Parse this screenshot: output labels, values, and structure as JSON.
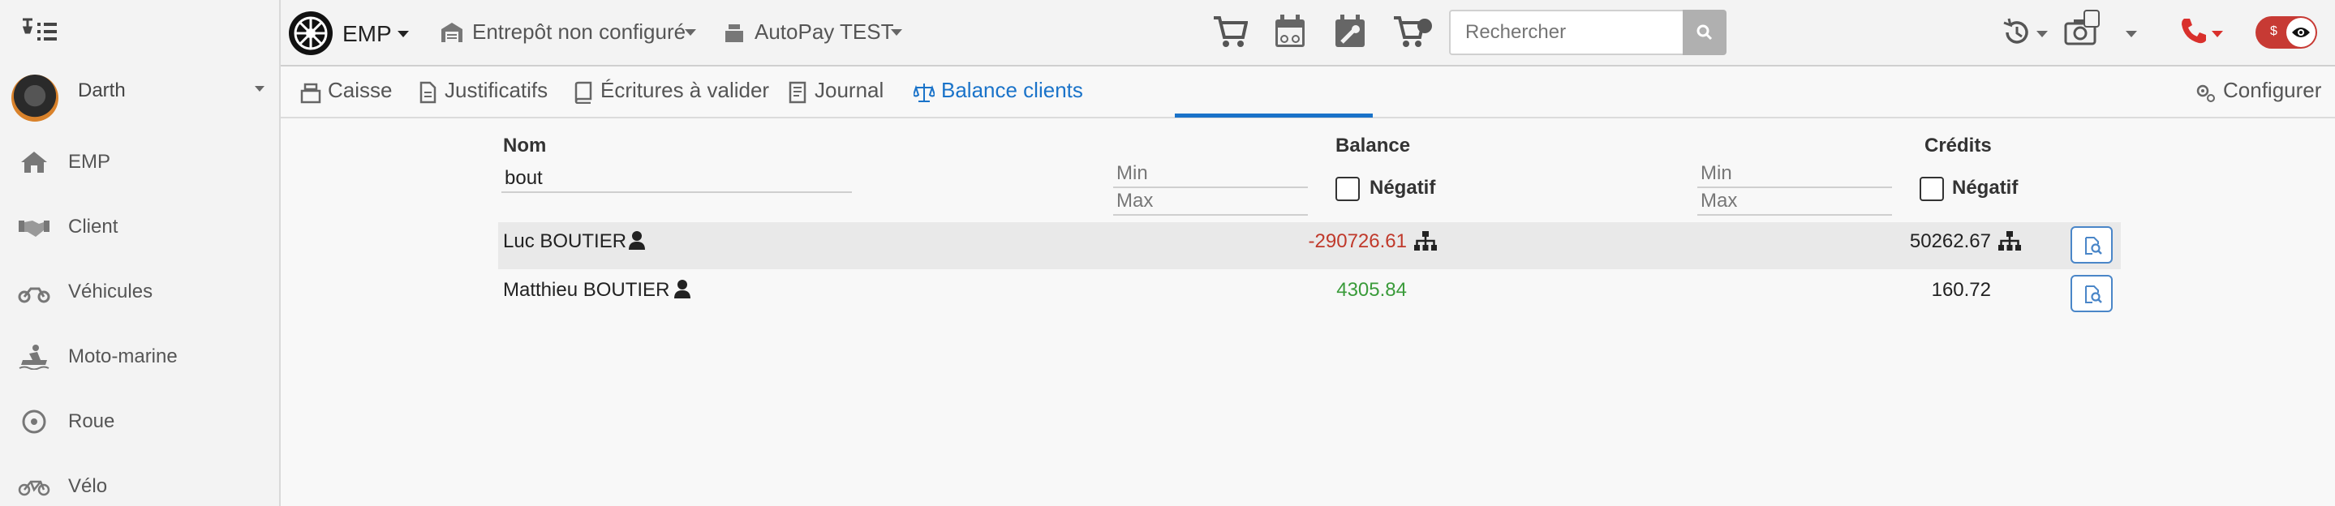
{
  "sidebar": {
    "user": {
      "name": "Darth"
    },
    "items": [
      {
        "label": "EMP",
        "icon": "home-icon"
      },
      {
        "label": "Client",
        "icon": "handshake-icon"
      },
      {
        "label": "Véhicules",
        "icon": "motorcycle-icon"
      },
      {
        "label": "Moto-marine",
        "icon": "jetski-icon"
      },
      {
        "label": "Roue",
        "icon": "wheel-icon"
      },
      {
        "label": "Vélo",
        "icon": "bicycle-icon"
      }
    ]
  },
  "topbar": {
    "brand": "EMP",
    "warehouse": "Entrepôt non configuré",
    "register": "AutoPay TEST",
    "search": {
      "placeholder": "Rechercher",
      "value": ""
    },
    "camera_badge": "",
    "toggle_label": "$"
  },
  "tabs": [
    {
      "label": "Caisse",
      "icon": "cash-register-icon"
    },
    {
      "label": "Justificatifs",
      "icon": "file-icon"
    },
    {
      "label": "Écritures à valider",
      "icon": "book-icon"
    },
    {
      "label": "Journal",
      "icon": "journal-icon"
    },
    {
      "label": "Balance clients",
      "icon": "balance-scale-icon",
      "active": true
    }
  ],
  "configure_label": "Configurer",
  "table": {
    "headers": {
      "name": "Nom",
      "balance": "Balance",
      "credits": "Crédits"
    },
    "filters": {
      "name_value": "bout",
      "balance_min_placeholder": "Min",
      "balance_max_placeholder": "Max",
      "credits_min_placeholder": "Min",
      "credits_max_placeholder": "Max",
      "balance_negative_label": "Négatif",
      "credits_negative_label": "Négatif"
    },
    "rows": [
      {
        "name": "Luc BOUTIER",
        "balance": "-290726.61",
        "credits": "50262.67"
      },
      {
        "name": "Matthieu BOUTIER",
        "balance": "4305.84",
        "credits": "160.72"
      }
    ]
  },
  "colors": {
    "accent": "#1a73c9",
    "negative": "#c0392b",
    "positive": "#3a9b3a",
    "danger": "#d9302c"
  }
}
